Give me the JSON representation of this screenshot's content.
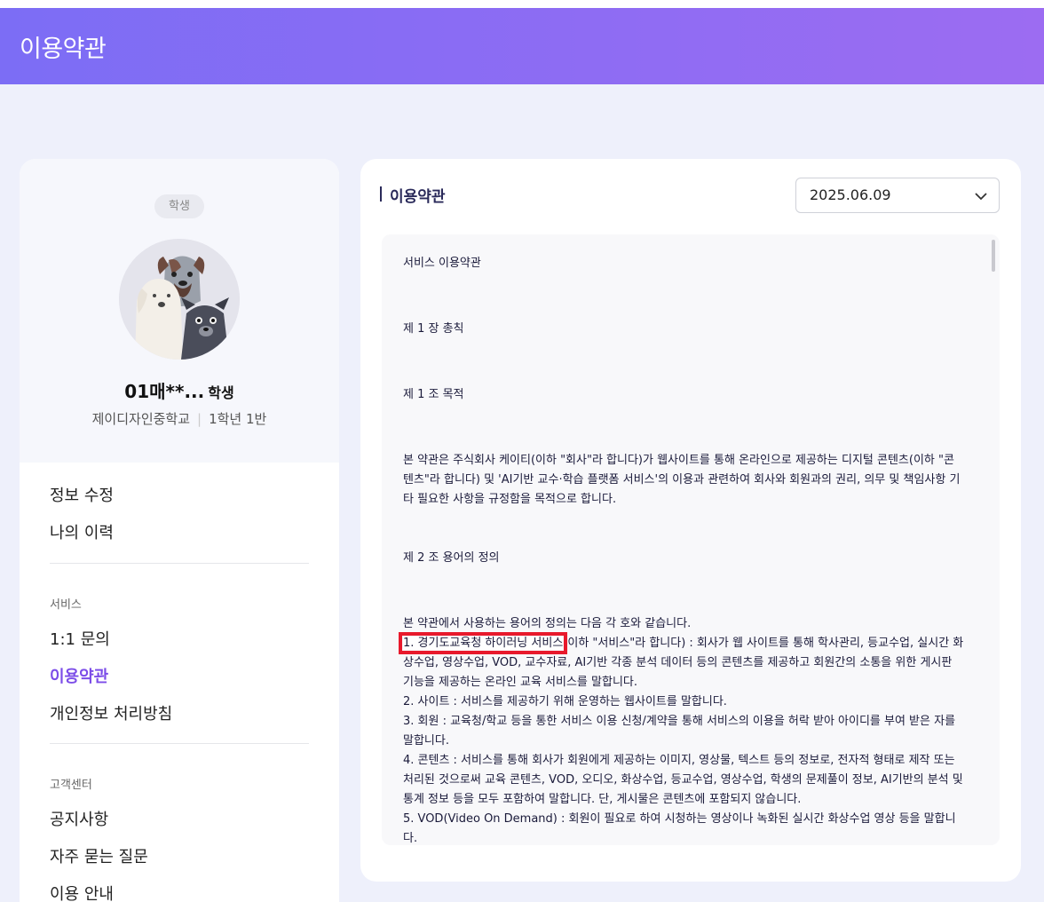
{
  "header": {
    "title": "이용약관"
  },
  "profile": {
    "role_chip": "학생",
    "name": "01매**...",
    "name_suffix": "학생",
    "school": "제이디자인중학교",
    "class": "1학년 1반"
  },
  "menu": {
    "edit_info": "정보 수정",
    "history": "나의 이력",
    "section_service": "서비스",
    "inquiry": "1:1 문의",
    "terms": "이용약관",
    "privacy": "개인정보 처리방침",
    "section_support": "고객센터",
    "notice": "공지사항",
    "faq": "자주 묻는 질문",
    "guide": "이용 안내"
  },
  "content": {
    "title": "이용약관",
    "date_selected": "2025.06.09"
  },
  "terms": {
    "heading": "서비스 이용약관",
    "chapter1": "제 1 장 총칙",
    "article1": "제 1 조 목적",
    "article1_body": "본 약관은 주식회사 케이티(이하 \"회사\"라 합니다)가 웹사이트를 통해 온라인으로 제공하는 디지털 콘텐츠(이하 \"콘텐츠\"라 합니다) 및 'AI기반 교수·학습 플랫폼 서비스'의 이용과 관련하여 회사와 회원과의 권리, 의무 및 책임사항 기타 필요한 사항을 규정함을 목적으로 합니다.",
    "article2": "제 2 조 용어의 정의",
    "article2_intro": "본 약관에서 사용하는 용어의 정의는 다음 각 호와 같습니다.",
    "def1_term": "1. 경기도교육청 하이러닝 서비스",
    "def1_rest": "(이하 \"서비스\"라 합니다) : 회사가 웹 사이트를 통해 학사관리, 등교수업, 실시간 화상수업, 영상수업, VOD, 교수자료, AI기반 각종 분석 데이터 등의 콘텐츠를 제공하고 회원간의 소통을 위한 게시판 기능을 제공하는 온라인 교육 서비스를 말합니다.",
    "def2": "2. 사이트 : 서비스를 제공하기 위해 운영하는 웹사이트를 말합니다.",
    "def3": "3. 회원 : 교육청/학교 등을 통한 서비스 이용 신청/계약을 통해 서비스의 이용을 허락 받아 아이디를 부여 받은 자를 말합니다.",
    "def4": "4. 콘텐츠 : 서비스를 통해 회사가 회원에게 제공하는 이미지, 영상물, 텍스트 등의 정보로, 전자적 형태로 제작 또는 처리된 것으로써 교육 콘텐츠, VOD, 오디오, 화상수업, 등교수업, 영상수업, 학생의 문제풀이 정보, AI기반의 분석 및 통계 정보 등을 모두 포함하여 말합니다. 단, 게시물은 콘텐츠에 포함되지 않습니다.",
    "def5": "5. VOD(Video On Demand) : 회원이 필요로 하여 시청하는 영상이나 녹화된 실시간 화상수업 영상 등을 말합니다."
  },
  "colors": {
    "accent": "#7c4de8",
    "header_start": "#7c6df5",
    "header_end": "#9c6cf2",
    "highlight": "#e8192c"
  }
}
